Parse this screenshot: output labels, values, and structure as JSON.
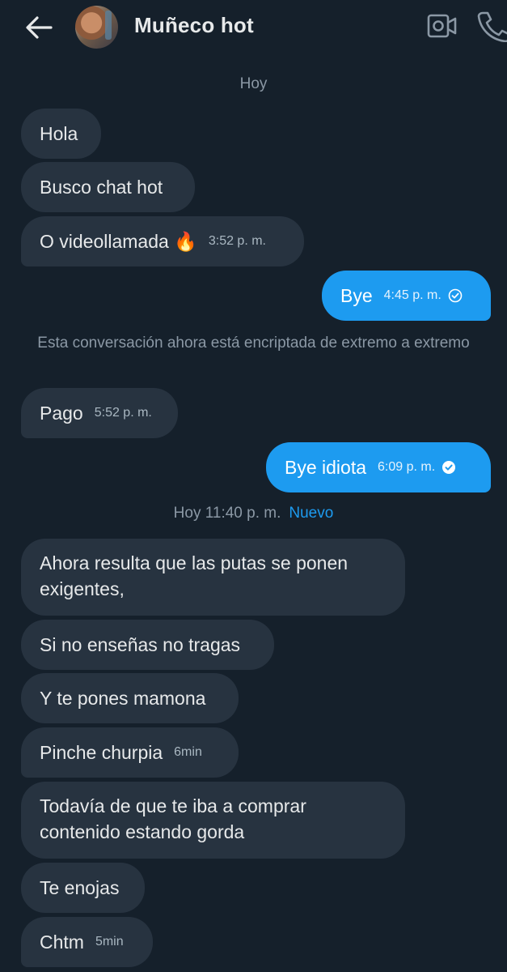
{
  "header": {
    "contact_name": "Muñeco hot",
    "icons": [
      "back-arrow-icon",
      "video-call-icon",
      "phone-icon"
    ]
  },
  "date_separator": "Hoy",
  "messages_group1": [
    {
      "text": "Hola",
      "time": ""
    },
    {
      "text": "Busco chat hot",
      "time": ""
    },
    {
      "text": "O videollamada 🔥",
      "time": "3:52 p. m."
    }
  ],
  "sent_1": {
    "text": "Bye",
    "time": "4:45 p. m."
  },
  "system_message": "Esta conversación ahora está encriptada de extremo a extremo",
  "received_2": {
    "text": "Pago",
    "time": "5:52 p. m."
  },
  "sent_2": {
    "text": "Bye idiota",
    "time": "6:09 p. m."
  },
  "new_separator": {
    "label": "Hoy 11:40 p. m.",
    "new": "Nuevo"
  },
  "messages_group2": [
    {
      "text": "Ahora resulta que las putas se ponen exigentes,",
      "time": ""
    },
    {
      "text": "Si no enseñas no tragas",
      "time": ""
    },
    {
      "text": "Y te pones mamona",
      "time": ""
    },
    {
      "text": "Pinche churpia",
      "time": "6min"
    },
    {
      "text": "Todavía de que te iba a comprar contenido estando gorda",
      "time": ""
    },
    {
      "text": "Te enojas",
      "time": ""
    },
    {
      "text": "Chtm",
      "time": "5min"
    }
  ],
  "colors": {
    "background": "#15202b",
    "incoming_bubble": "#273340",
    "outgoing_bubble": "#1d9bf0",
    "muted_text": "#8b98a5",
    "accent": "#1d9bf0"
  }
}
